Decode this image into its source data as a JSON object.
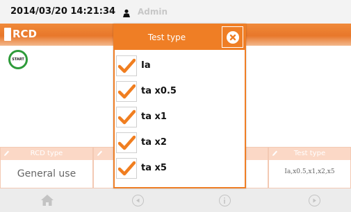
{
  "status": {
    "datetime": "2014/03/20 14:21:34",
    "user": "Admin"
  },
  "header": {
    "title": "RCD"
  },
  "start": {
    "label": "START"
  },
  "tiles": [
    {
      "head": "RCD type",
      "value": "General use"
    },
    {
      "head": "",
      "value": ""
    },
    {
      "head": "",
      "value": ""
    },
    {
      "head": "Test type",
      "value": "Ia,x0.5,x1,x2,x5"
    }
  ],
  "dialog": {
    "title": "Test type",
    "options": [
      {
        "label": "Ia",
        "checked": true
      },
      {
        "label": "ta x0.5",
        "checked": true
      },
      {
        "label": "ta x1",
        "checked": true
      },
      {
        "label": "ta x2",
        "checked": true
      },
      {
        "label": "ta x5",
        "checked": true
      }
    ]
  },
  "colors": {
    "accent": "#ef7e25",
    "start_ring": "#2e9b3a",
    "tile_head": "#fbd8c6",
    "nav_icon": "#c3c3c3"
  },
  "icons": [
    "user-icon",
    "rcd-icon",
    "start-icon",
    "pencil-icon",
    "close-icon",
    "checkmark-icon",
    "home-icon",
    "left-arrow-icon",
    "info-icon",
    "right-arrow-icon"
  ]
}
